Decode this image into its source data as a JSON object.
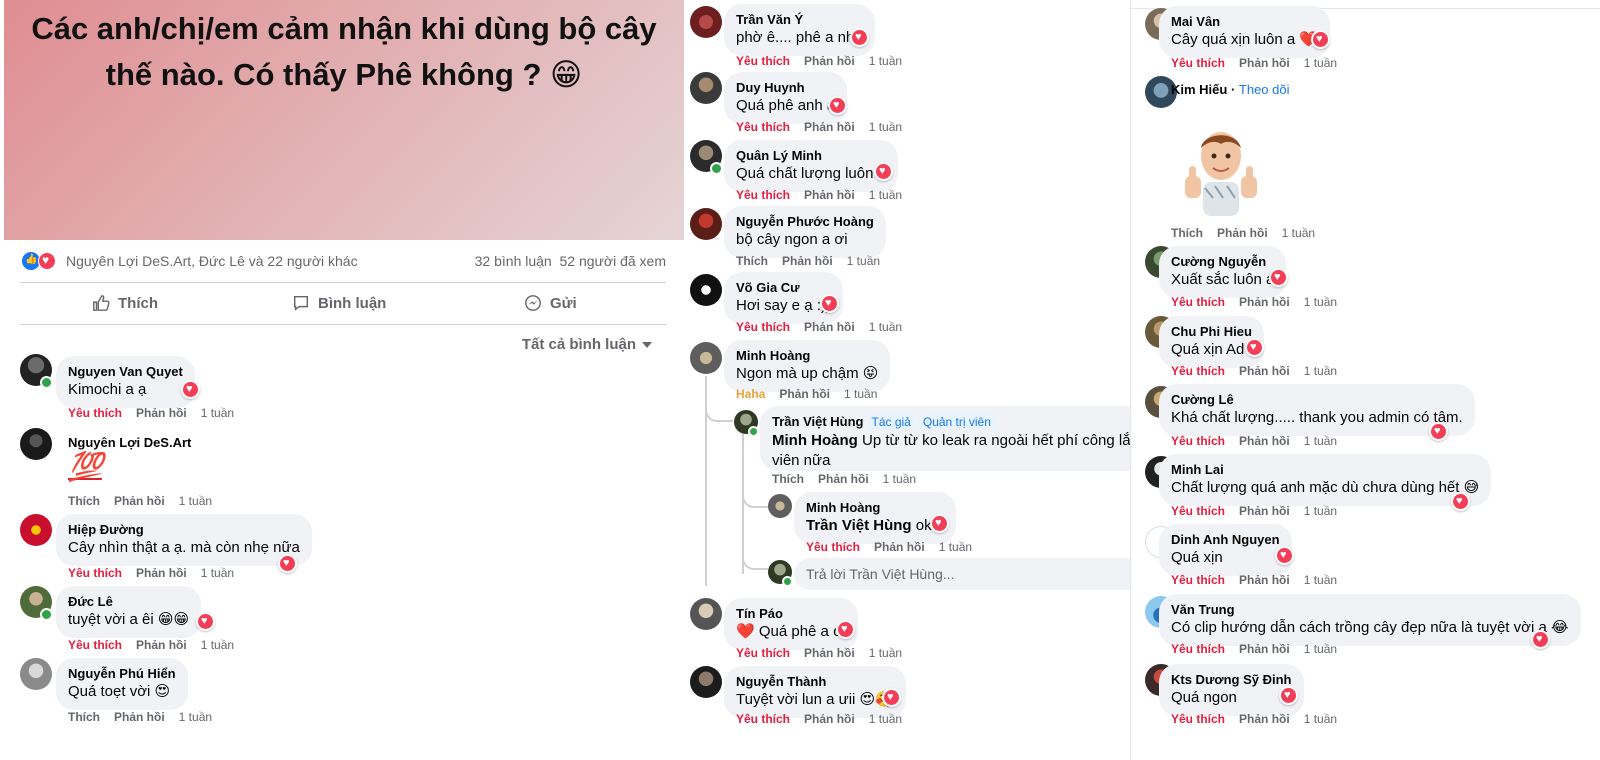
{
  "post": {
    "text": "Các anh/chị/em cảm nhận khi dùng bộ cây thế nào. Có thấy Phê không ? 😁",
    "reactors": "Nguyên Lợi DeS.Art, Đức Lê và 22 người khác",
    "comment_count": "32 bình luận",
    "view_count": "52 người đã xem",
    "actions": {
      "like": "Thích",
      "comment": "Bình luận",
      "send": "Gửi"
    },
    "sort_label": "Tất cả bình luận",
    "colors": {
      "like_blue": "#1877f2",
      "love_red": "#f33e58",
      "liked_text": "#e41e3f"
    }
  },
  "labels": {
    "liked": "Yêu thích",
    "like": "Thích",
    "haha": "Haha",
    "reply": "Phản hồi",
    "time": "1 tuần",
    "follow": "Theo dõi",
    "author_badge": "Tác giả",
    "admin_badge": "Quản trị viên",
    "reply_placeholder": "Trả lời Trần Việt Hùng..."
  },
  "comments_left": [
    {
      "name": "Nguyen Van Quyet",
      "text": "Kimochi a ạ"
    },
    {
      "name": "Nguyên Lợi DeS.Art",
      "text": "💯"
    },
    {
      "name": "Hiệp Đường",
      "text": "Cây nhìn thật a ạ. mà còn nhẹ nữa"
    },
    {
      "name": "Đức Lê",
      "text": "tuyệt vời a êi 😁😁"
    },
    {
      "name": "Nguyễn Phú Hiển",
      "text": "Quá toẹt vời 😍"
    }
  ],
  "comments_mid": [
    {
      "name": "Trần Văn Ý",
      "text": "phờ ê.... phê a nhé"
    },
    {
      "name": "Duy Huynh",
      "text": "Quá phê anh ạ"
    },
    {
      "name": "Quân Lý Minh",
      "text": "Quá chất lượng luôn a"
    },
    {
      "name": "Nguyễn Phước Hoàng",
      "text": "bộ cây ngon a ơi"
    },
    {
      "name": "Võ Gia Cư",
      "text": "Hơi say e ạ :))"
    },
    {
      "name": "Minh Hoàng",
      "text": "Ngon mà up chậm 😝"
    },
    {
      "name": "Trần Việt Hùng",
      "mention": "Minh Hoàng",
      "text": "Up từ từ ko leak ra ngoài hết phí công lắm",
      "text2": "viên nữa"
    },
    {
      "name": "Minh Hoàng",
      "mention": "Trần Việt Hùng",
      "text": "ok e"
    },
    {
      "name": "Tín Páo",
      "text": "❤️ Quá phê a ơi"
    },
    {
      "name": "Nguyễn Thành",
      "text": "Tuyệt vời lun a ưii 😍🥰"
    }
  ],
  "comments_right": [
    {
      "name": "Mai Vân",
      "text": "Cây quá xịn luôn a ❤️"
    },
    {
      "name": "Kim Hiếu"
    },
    {
      "name": "Cường Nguyễn",
      "text": "Xuất sắc luôn a"
    },
    {
      "name": "Chu Phi Hieu",
      "text": "Quá xịn Ad"
    },
    {
      "name": "Cường Lê",
      "text": "Khá chất lượng..... thank you admin có tâm."
    },
    {
      "name": "Minh Lai",
      "text": "Chất lượng quá anh mặc dù chưa dùng hết 😅"
    },
    {
      "name": "Dinh Anh Nguyen",
      "text": "Quá xịn"
    },
    {
      "name": "Văn Trung",
      "text": "Có clip hướng dẫn cách trồng cây đẹp nữa là tuyệt vời a 😂"
    },
    {
      "name": "Kts Dương Sỹ Đinh",
      "text": "Quá ngon"
    }
  ]
}
